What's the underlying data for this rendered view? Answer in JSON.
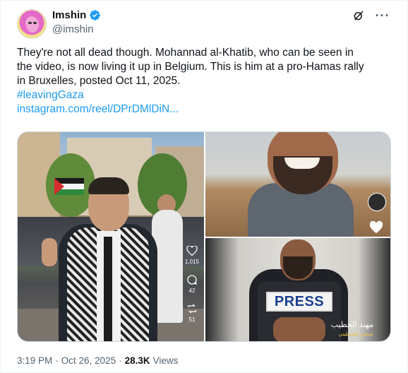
{
  "author": {
    "display_name": "Imshin",
    "handle": "@imshin",
    "verified": true,
    "avatar_icon": "profile-photo"
  },
  "actions": {
    "grok_icon": "grok-icon",
    "more_label": "···"
  },
  "tweet": {
    "lines": [
      "They're not all dead though. Mohannad al-Khatib, who can be seen in",
      "the video, is now living it up in Belgium. This is him at a pro-Hamas rally",
      "in Bruxelles, posted Oct 11, 2025."
    ],
    "hashtag": "#leavingGaza",
    "link": "instagram.com/reel/DPrDMlDiN..."
  },
  "media": {
    "left_tile": {
      "reel_likes": "1,015",
      "reel_comments": "42",
      "reel_shares": "51"
    },
    "bottom_right_tile": {
      "vest_text": "PRESS",
      "caption": "مهند الخطيب",
      "sub_caption": "صحفي فلسطيني"
    }
  },
  "meta": {
    "time": "3:19 PM",
    "separator": "·",
    "date": "Oct 26, 2025",
    "views_count": "28.3K",
    "views_label": "Views"
  },
  "colors": {
    "link": "#1d9bf0",
    "verified": "#1d9bf0",
    "secondary_text": "#536471"
  }
}
